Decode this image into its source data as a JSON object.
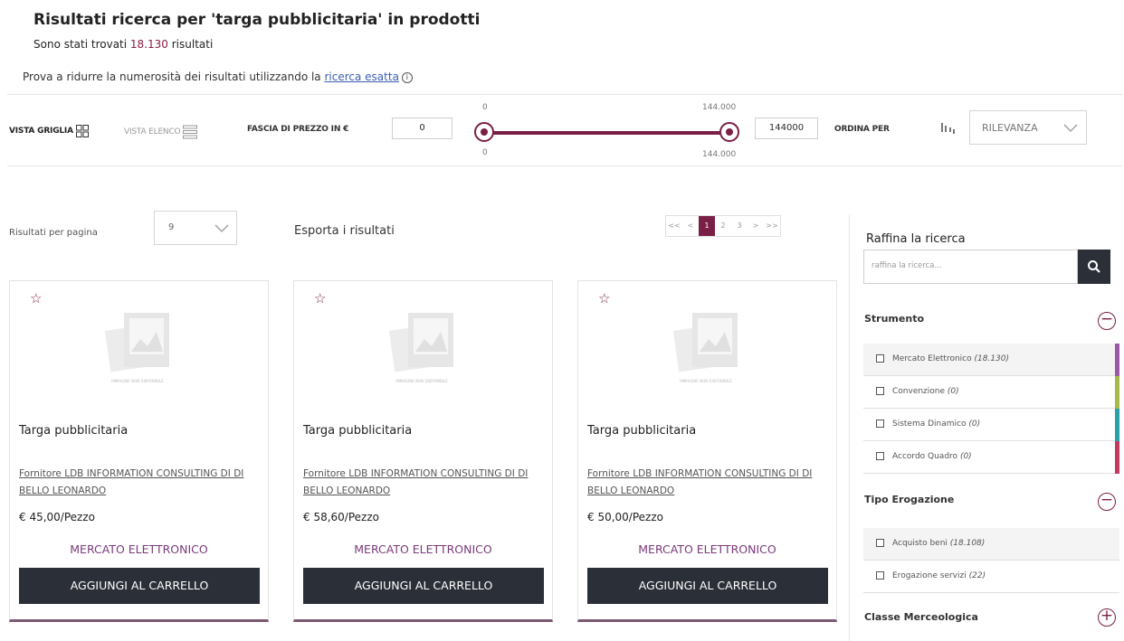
{
  "header": {
    "title": "Risultati ricerca per 'targa pubblicitaria' in prodotti",
    "found_prefix": "Sono stati trovati ",
    "found_count": "18.130",
    "found_suffix": " risultati",
    "hint_prefix": "Prova a ridurre la numerosità dei risultati utilizzando la ",
    "hint_link": "ricerca esatta",
    "info_glyph": "i"
  },
  "toolbar": {
    "vista_griglia": "VISTA GRIGLIA",
    "vista_elenco": "VISTA ELENCO",
    "fascia_label": "FASCIA DI PREZZO IN €",
    "price_min": "0",
    "price_max": "144000",
    "tick_min": "0",
    "tick_max": "144.000",
    "ordina_label": "ORDINA PER",
    "sort_value": "RILEVANZA"
  },
  "results": {
    "per_page_label": "Risultati per pagina",
    "per_page_value": "9",
    "export_label": "Esporta i risultati"
  },
  "pagination": [
    "<<",
    "<",
    "1",
    "2",
    "3",
    ">",
    ">>"
  ],
  "products": [
    {
      "name": "Targa pubblicitaria",
      "supplier": "Fornitore LDB INFORMATION CONSULTING DI DI BELLO LEONARDO",
      "price": "€ 45,00/Pezzo",
      "market": "MERCATO ELETTRONICO",
      "cart": "AGGIUNGI AL CARRELLO",
      "placeholder": "IMMAGINE NON DISPONIBILE"
    },
    {
      "name": "Targa pubblicitaria",
      "supplier": "Fornitore LDB INFORMATION CONSULTING DI DI BELLO LEONARDO",
      "price": "€ 58,60/Pezzo",
      "market": "MERCATO ELETTRONICO",
      "cart": "AGGIUNGI AL CARRELLO",
      "placeholder": "IMMAGINE NON DISPONIBILE"
    },
    {
      "name": "Targa pubblicitaria",
      "supplier": "Fornitore LDB INFORMATION CONSULTING DI DI BELLO LEONARDO",
      "price": "€ 50,00/Pezzo",
      "market": "MERCATO ELETTRONICO",
      "cart": "AGGIUNGI AL CARRELLO",
      "placeholder": "IMMAGINE NON DISPONIBILE"
    }
  ],
  "sidebar": {
    "title": "Raffina la ricerca",
    "placeholder": "raffina la ricerca...",
    "strumento": {
      "title": "Strumento",
      "toggle": "−",
      "options": [
        {
          "label": "Mercato Elettronico",
          "count": "(18.130)",
          "color": "#9b59a8"
        },
        {
          "label": "Convenzione",
          "count": "(0)",
          "color": "#a8b84a"
        },
        {
          "label": "Sistema Dinamico",
          "count": "(0)",
          "color": "#2aa0a8"
        },
        {
          "label": "Accordo Quadro",
          "count": "(0)",
          "color": "#c23a5e"
        }
      ]
    },
    "tipo": {
      "title": "Tipo Erogazione",
      "toggle": "−",
      "options": [
        {
          "label": "Acquisto beni",
          "count": "(18.108)"
        },
        {
          "label": "Erogazione servizi",
          "count": "(22)"
        }
      ]
    },
    "classe": {
      "title": "Classe Merceologica",
      "toggle": "+"
    }
  },
  "colors": {
    "accent": "#7a1f45",
    "button_dark": "#2b2f38",
    "market_text": "#7a3a7a",
    "link": "#3a5fb0"
  }
}
